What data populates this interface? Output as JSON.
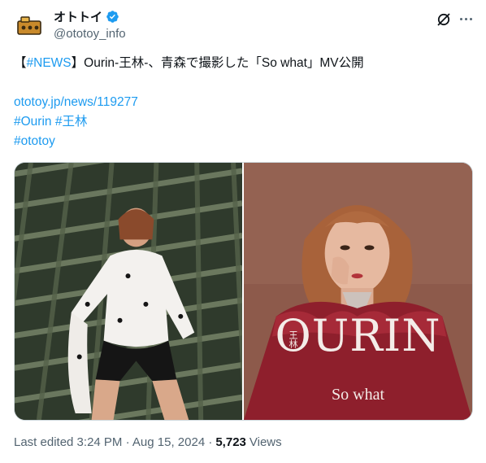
{
  "account": {
    "display_name": "オトトイ",
    "handle": "@ototoy_info",
    "verified": true
  },
  "tweet": {
    "line1_open": "【",
    "line1_hashtag": "#NEWS",
    "line1_rest": "】Ourin-王林-、青森で撮影した「So what」MV公開",
    "link_url": "ototoy.jp/news/119277",
    "hashtag_ourin": "#Ourin",
    "hashtag_kanji": "#王林",
    "hashtag_ototoy": "#ototoy"
  },
  "media": {
    "right_title": "OURIN",
    "right_kanji": "王林",
    "right_subtitle": "So what"
  },
  "footer": {
    "edited_label": "Last edited 3:24 PM · Aug 15, 2024 ·",
    "views_count": "5,723",
    "views_label": "Views"
  },
  "colors": {
    "link": "#1d9bf0",
    "verified": "#1d9bf0",
    "text": "#0f1419",
    "secondary": "#536471"
  },
  "icons": {
    "verified": "verified-badge-icon",
    "grok": "grok-icon",
    "more": "more-options-icon"
  }
}
